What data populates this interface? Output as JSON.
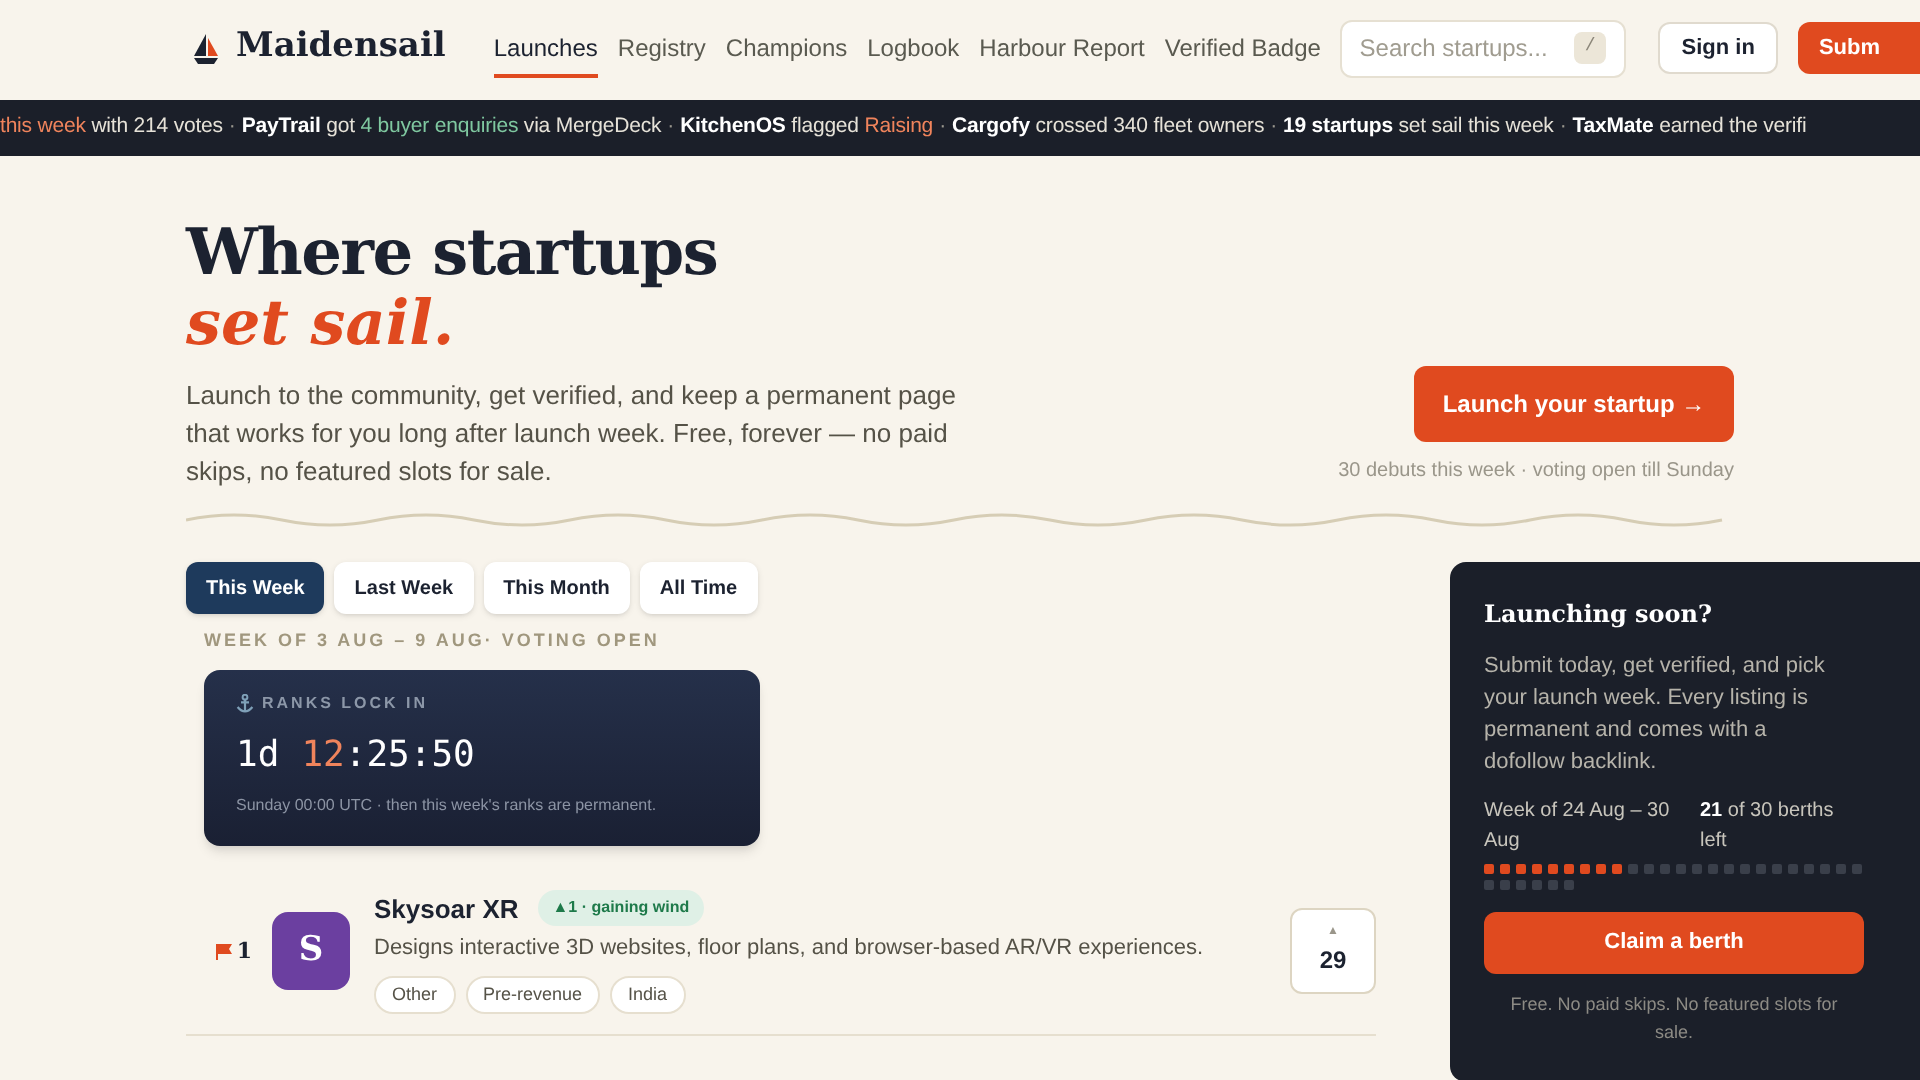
{
  "nav": {
    "brand": "Maidensail",
    "links": [
      {
        "label": "Launches",
        "selected": true
      },
      {
        "label": "Registry",
        "selected": false
      },
      {
        "label": "Champions",
        "selected": false
      },
      {
        "label": "Logbook",
        "selected": false
      },
      {
        "label": "Harbour Report",
        "selected": false
      },
      {
        "label": "Verified Badge",
        "selected": false
      }
    ],
    "search": {
      "placeholder": "Search startups...",
      "shortcut": "/"
    },
    "sign_in": "Sign in",
    "submit": "Subm"
  },
  "ticker": [
    {
      "parts": [
        {
          "kind": "orange",
          "text": "this week"
        },
        {
          "kind": "plain",
          "text": " with 214 votes"
        }
      ],
      "sep": "·"
    },
    {
      "parts": [
        {
          "kind": "bold",
          "text": "PayTrail"
        },
        {
          "kind": "plain",
          "text": " got "
        },
        {
          "kind": "green",
          "text": "4 buyer enquiries"
        },
        {
          "kind": "plain",
          "text": " via MergeDeck"
        }
      ],
      "sep": "·"
    },
    {
      "parts": [
        {
          "kind": "bold",
          "text": "KitchenOS"
        },
        {
          "kind": "plain",
          "text": " flagged "
        },
        {
          "kind": "orange",
          "text": "Raising"
        }
      ],
      "sep": "·"
    },
    {
      "parts": [
        {
          "kind": "bold",
          "text": "Cargofy"
        },
        {
          "kind": "plain",
          "text": " crossed 340 fleet owners"
        }
      ],
      "sep": "·"
    },
    {
      "parts": [
        {
          "kind": "bold",
          "text": "19 startups"
        },
        {
          "kind": "plain",
          "text": " set sail this week"
        }
      ],
      "sep": "·"
    },
    {
      "parts": [
        {
          "kind": "bold",
          "text": "TaxMate"
        },
        {
          "kind": "plain",
          "text": " earned the verifi"
        }
      ]
    }
  ],
  "hero": {
    "title": "Where startups",
    "title_accent": "set sail.",
    "text": "Launch to the community, get verified, and keep a permanent page that works for you long after launch week. Free, forever — no paid skips, no featured slots for sale.",
    "cta": "Launch your startup →",
    "note": "30 debuts this week · voting open till Sunday"
  },
  "tabs": [
    {
      "label": "This Week",
      "selected": true
    },
    {
      "label": "Last Week",
      "selected": false
    },
    {
      "label": "This Month",
      "selected": false
    },
    {
      "label": "All Time",
      "selected": false
    }
  ],
  "week_label": "WEEK OF 3 AUG – 9 AUG· VOTING OPEN",
  "countdown": {
    "label": "RANKS LOCK IN",
    "days": "1d",
    "hours": "12",
    "rest": ":25:50",
    "note": "Sunday 00:00 UTC · then this week's ranks are permanent."
  },
  "launches": [
    {
      "rank": "1",
      "initial": "S",
      "color": "#6b3fa0",
      "name": "Skysoar XR",
      "badge": "▲1 · gaining wind",
      "description": "Designs interactive 3D websites, floor plans, and browser-based AR/VR experiences.",
      "tags": [
        "Other",
        "Pre-revenue",
        "India"
      ],
      "vote_arrow": "▲",
      "votes": "29"
    }
  ],
  "sidebar": {
    "title": "Launching soon?",
    "text": "Submit today, get verified, and pick your launch week. Every listing is permanent and comes with a dofollow backlink.",
    "week": "Week of 24 Aug – 30 Aug",
    "berths_count": "21",
    "berths_text": " of 30 berths left",
    "level": 0.3,
    "button": "Claim a berth",
    "note": "Free. No paid skips. No featured slots for sale."
  }
}
